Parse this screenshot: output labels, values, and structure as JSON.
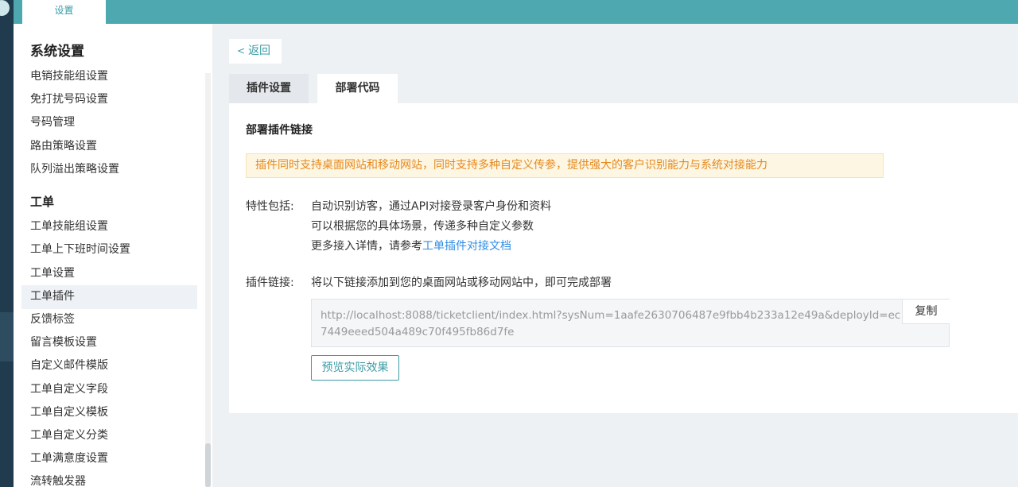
{
  "topbar": {
    "tab_label": "设置"
  },
  "sidebar": {
    "title": "系统设置",
    "items": [
      {
        "label": "电销技能组设置",
        "kind": "item"
      },
      {
        "label": "免打扰号码设置",
        "kind": "item"
      },
      {
        "label": "号码管理",
        "kind": "item"
      },
      {
        "label": "路由策略设置",
        "kind": "item"
      },
      {
        "label": "队列溢出策略设置",
        "kind": "item"
      },
      {
        "label": "工单",
        "kind": "head"
      },
      {
        "label": "工单技能组设置",
        "kind": "item"
      },
      {
        "label": "工单上下班时间设置",
        "kind": "item"
      },
      {
        "label": "工单设置",
        "kind": "item"
      },
      {
        "label": "工单插件",
        "kind": "item",
        "active": true
      },
      {
        "label": "反馈标签",
        "kind": "item"
      },
      {
        "label": "留言模板设置",
        "kind": "item"
      },
      {
        "label": "自定义邮件模版",
        "kind": "item"
      },
      {
        "label": "工单自定义字段",
        "kind": "item"
      },
      {
        "label": "工单自定义模板",
        "kind": "item"
      },
      {
        "label": "工单自定义分类",
        "kind": "item"
      },
      {
        "label": "工单满意度设置",
        "kind": "item"
      },
      {
        "label": "流转触发器",
        "kind": "item"
      }
    ]
  },
  "main": {
    "back_label": "返回",
    "tabs": [
      {
        "label": "插件设置",
        "active": false
      },
      {
        "label": "部署代码",
        "active": true
      }
    ],
    "section_title": "部署插件链接",
    "notice": "插件同时支持桌面网站和移动网站，同时支持多种自定义传参，提供强大的客户识别能力与系统对接能力",
    "features_label": "特性包括:",
    "features": [
      "自动识别访客，通过API对接登录客户身份和资料",
      "可以根据您的具体场景，传递多种自定义参数"
    ],
    "more_prefix": "更多接入详情，请参考",
    "more_link": "工单插件对接文档",
    "link_label": "插件链接:",
    "link_desc": "将以下链接添加到您的桌面网站或移动网站中，即可完成部署",
    "url": "http://localhost:8088/ticketclient/index.html?sysNum=1aafe2630706487e9fbb4b233a12e49a&deployId=ec7449eeed504a489c70f495fb86d7fe",
    "copy_label": "复制",
    "preview_label": "预览实际效果"
  },
  "colors": {
    "accent": "#4da8b0",
    "notice_text": "#e58a1f",
    "link": "#2f8de4"
  }
}
